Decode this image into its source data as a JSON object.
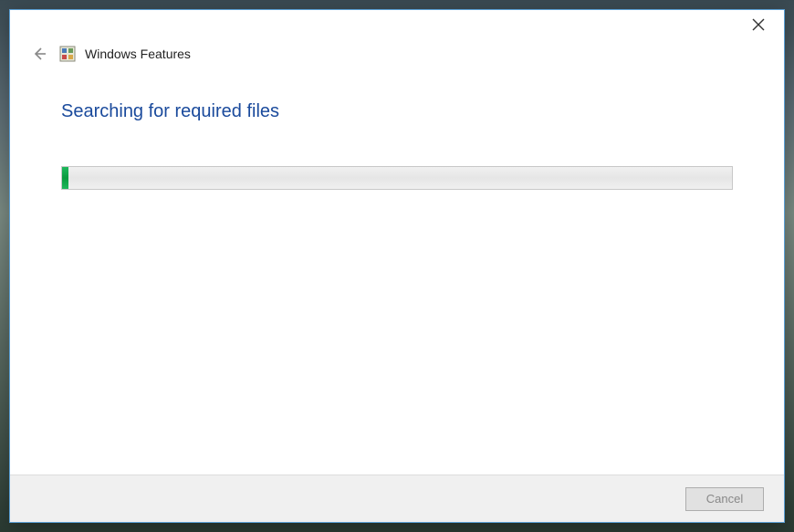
{
  "header": {
    "title": "Windows Features"
  },
  "content": {
    "heading": "Searching for required files",
    "progress_percent": 1
  },
  "footer": {
    "cancel_label": "Cancel"
  }
}
